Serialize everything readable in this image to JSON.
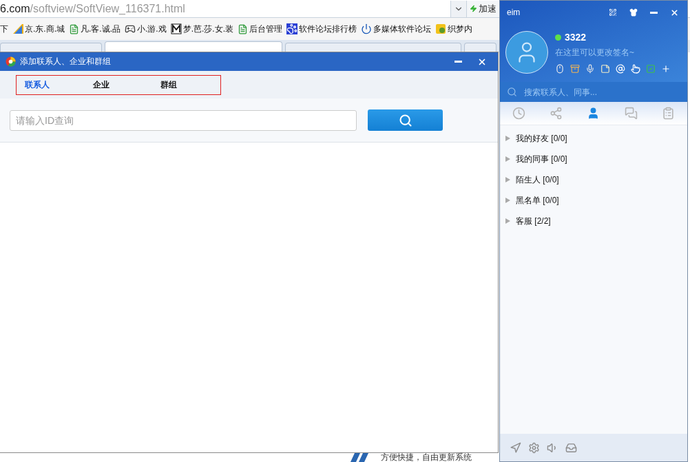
{
  "browser": {
    "address": {
      "host": "6.com",
      "path": "/softview/SoftView_116371.html"
    },
    "speed_button": "加速",
    "bookmarks": [
      {
        "label": "下",
        "kind": "text"
      },
      {
        "label": "京.东.商.城",
        "kind": "stripe"
      },
      {
        "label": "凡.客.诚.品",
        "kind": "page"
      },
      {
        "label": "小.游.戏",
        "kind": "gamepad"
      },
      {
        "label": "梦.芭.莎.女.装",
        "kind": "letter"
      },
      {
        "label": "后台管理",
        "kind": "page"
      },
      {
        "label": "软件论坛排行榜",
        "kind": "paw"
      },
      {
        "label": "多媒体软件论坛",
        "kind": "power"
      },
      {
        "label": "织梦内",
        "kind": "badge"
      }
    ],
    "tabs": [
      {
        "selected": false
      },
      {
        "selected": true
      },
      {
        "selected": false
      },
      {
        "selected": false
      }
    ],
    "bottom_text": "方便快捷，自由更新系统"
  },
  "dialog": {
    "title": "添加联系人、企业和群组",
    "tabs": [
      {
        "label": "联系人",
        "selected": true
      },
      {
        "label": "企业",
        "selected": false
      },
      {
        "label": "群组",
        "selected": false
      }
    ],
    "search": {
      "placeholder": "请输入ID查询"
    }
  },
  "eim": {
    "title": "eim",
    "user": {
      "name": "3322",
      "online": true,
      "signature": "在这里可以更改签名~"
    },
    "search": {
      "placeholder": "搜索联系人、同事..."
    },
    "nav": [
      {
        "kind": "recent",
        "selected": false
      },
      {
        "kind": "org",
        "selected": false
      },
      {
        "kind": "contacts",
        "selected": true
      },
      {
        "kind": "chats",
        "selected": false
      },
      {
        "kind": "apps",
        "selected": false
      }
    ],
    "groups": [
      {
        "label": "我的好友 [0/0]",
        "expanded": false
      },
      {
        "label": "我的同事 [0/0]",
        "expanded": false
      },
      {
        "label": "陌生人 [0/0]",
        "expanded": false
      },
      {
        "label": "黑名单 [0/0]",
        "expanded": false
      },
      {
        "label": "客服 [2/2]",
        "expanded": false
      }
    ]
  }
}
